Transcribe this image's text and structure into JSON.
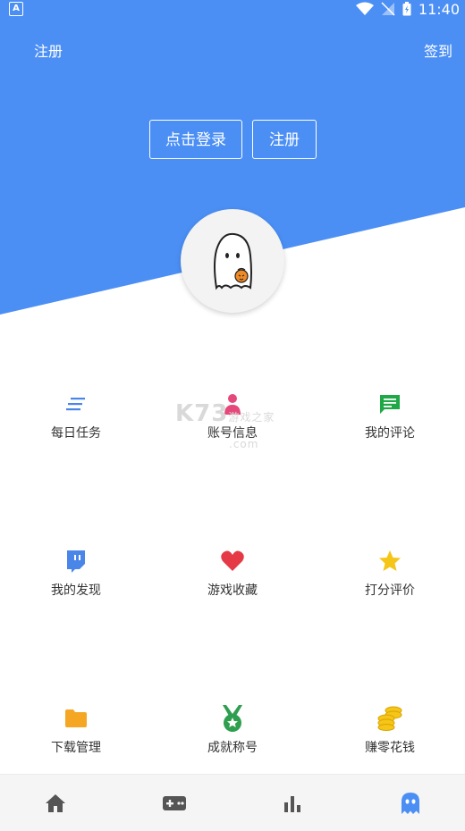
{
  "status_bar": {
    "time": "11:40"
  },
  "header": {
    "register_link": "注册",
    "sign_in_link": "签到",
    "login_button": "点击登录",
    "register_button": "注册"
  },
  "menu": [
    {
      "label": "每日任务",
      "icon": "list-icon",
      "color": "#4a86e8"
    },
    {
      "label": "账号信息",
      "icon": "person-icon",
      "color": "#e5487a"
    },
    {
      "label": "我的评论",
      "icon": "comment-icon",
      "color": "#1fa845"
    },
    {
      "label": "我的发现",
      "icon": "twitch-icon",
      "color": "#4a86e8"
    },
    {
      "label": "游戏收藏",
      "icon": "heart-icon",
      "color": "#e53946"
    },
    {
      "label": "打分评价",
      "icon": "star-icon",
      "color": "#f5c518"
    },
    {
      "label": "下载管理",
      "icon": "folder-icon",
      "color": "#f5a623"
    },
    {
      "label": "成就称号",
      "icon": "medal-icon",
      "color": "#2e9e4f"
    },
    {
      "label": "赚零花钱",
      "icon": "coins-icon",
      "color": "#f5c518"
    }
  ],
  "watermark": {
    "text": "K73",
    "sub": "游戏之家",
    "sub2": ".com"
  },
  "bottom_nav": [
    "home-icon",
    "gamepad-icon",
    "bar-chart-icon",
    "ghost-icon"
  ],
  "colors": {
    "header_blue": "#4b8ff5",
    "active_nav": "#4b8ff5",
    "inactive_nav": "#555555"
  }
}
